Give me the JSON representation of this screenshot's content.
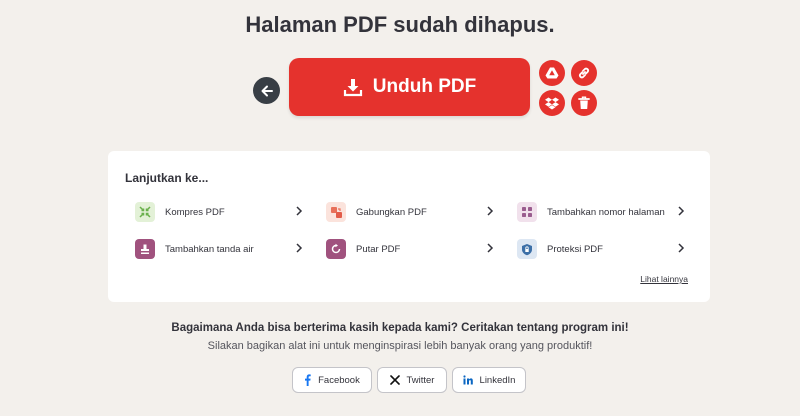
{
  "title": "Halaman PDF sudah dihapus.",
  "actions": {
    "back_icon": "arrow-left-icon",
    "download_label": "Unduh PDF",
    "download_icon": "download-icon",
    "drive_icon": "google-drive-icon",
    "link_icon": "link-icon",
    "dropbox_icon": "dropbox-icon",
    "trash_icon": "trash-icon",
    "accent_color": "#e5322d"
  },
  "continue": {
    "title": "Lanjutkan ke...",
    "tools": [
      {
        "label": "Kompres PDF",
        "icon": "compress-icon",
        "color": "#6ab04c"
      },
      {
        "label": "Gabungkan PDF",
        "icon": "merge-icon",
        "color": "#e8705a"
      },
      {
        "label": "Tambahkan nomor halaman",
        "icon": "page-numbers-icon",
        "color": "#9a5c8e"
      },
      {
        "label": "Tambahkan tanda air",
        "icon": "watermark-icon",
        "color": "#a0527e"
      },
      {
        "label": "Putar PDF",
        "icon": "rotate-icon",
        "color": "#a0527e"
      },
      {
        "label": "Proteksi PDF",
        "icon": "protect-icon",
        "color": "#3c6fa7"
      }
    ],
    "see_more": "Lihat lainnya"
  },
  "feedback": {
    "headline": "Bagaimana Anda bisa berterima kasih kepada kami? Ceritakan tentang program ini!",
    "subline": "Silakan bagikan alat ini untuk menginspirasi lebih banyak orang yang produktif!"
  },
  "share": [
    {
      "label": "Facebook",
      "icon": "facebook-icon",
      "color": "#1877f2"
    },
    {
      "label": "Twitter",
      "icon": "x-twitter-icon",
      "color": "#111111"
    },
    {
      "label": "LinkedIn",
      "icon": "linkedin-icon",
      "color": "#0a66c2"
    }
  ]
}
